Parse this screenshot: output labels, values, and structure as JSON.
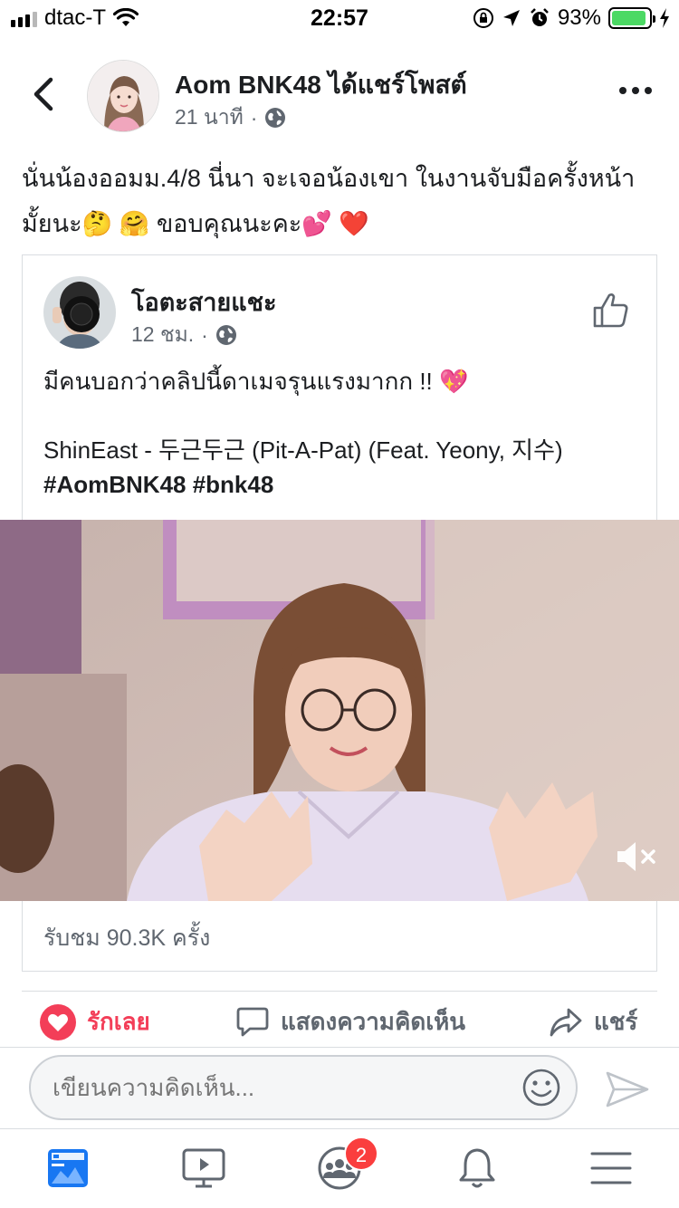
{
  "status_bar": {
    "carrier": "dtac-T",
    "time": "22:57",
    "battery_percent": "93%",
    "battery_level": 0.93
  },
  "header": {
    "title": "Aom BNK48 ได้แชร์โพสต์",
    "time_ago": "21 นาที",
    "separator": "·"
  },
  "post": {
    "text": "นั่นน้องออมม.4/8 นี่นา จะเจอน้องเขา ในงานจับมือครั้งหน้ามั้ยนะ🤔 🤗 ขอบคุณนะคะ💕 ❤️"
  },
  "shared": {
    "author": "โอตะสายแชะ",
    "time_ago": "12 ชม.",
    "separator": "·",
    "line1": "มีคนบอกว่าคลิปนี้ดาเมจรุนแรงมากก  !! 💖",
    "line2": "ShinEast - 두근두근 (Pit-A-Pat) (Feat. Yeony, 지수)",
    "hashtags": "#AomBNK48 #bnk48",
    "views": "รับชม 90.3K ครั้ง"
  },
  "actions": {
    "love": "รักเลย",
    "comment": "แสดงความคิดเห็น",
    "share": "แชร์"
  },
  "comment_box": {
    "placeholder": "เขียนความคิดเห็น..."
  },
  "tab_bar": {
    "items": [
      "news-feed",
      "watch",
      "groups",
      "notifications",
      "menu"
    ],
    "groups_badge": "2"
  },
  "colors": {
    "love": "#f33e58",
    "facebook_blue": "#1877f2",
    "badge": "#fa3e3e",
    "battery": "#4cd964"
  }
}
